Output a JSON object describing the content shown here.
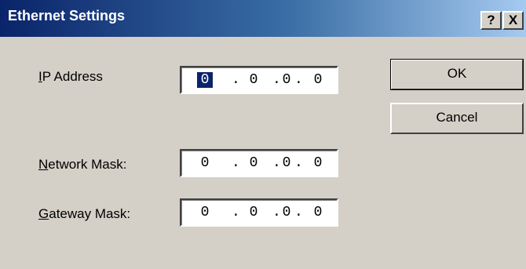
{
  "window": {
    "title": "Ethernet Settings",
    "help_label": "?",
    "close_label": "X"
  },
  "fields": [
    {
      "label_mnemonic": "I",
      "label_rest": "P Address",
      "octets": [
        "0",
        "0",
        "0",
        "0"
      ]
    },
    {
      "label_mnemonic": "N",
      "label_rest": "etwork Mask:",
      "octets": [
        "0",
        "0",
        "0",
        "0"
      ]
    },
    {
      "label_mnemonic": "G",
      "label_rest": "ateway Mask:",
      "octets": [
        "0",
        "0",
        "0",
        "0"
      ]
    }
  ],
  "buttons": {
    "ok_label": "OK",
    "cancel_label": "Cancel"
  },
  "colors": {
    "titlebar_start": "#0a246a",
    "titlebar_end": "#a6caf0",
    "dialog_bg": "#d4d0c8",
    "selection": "#0a246a"
  }
}
